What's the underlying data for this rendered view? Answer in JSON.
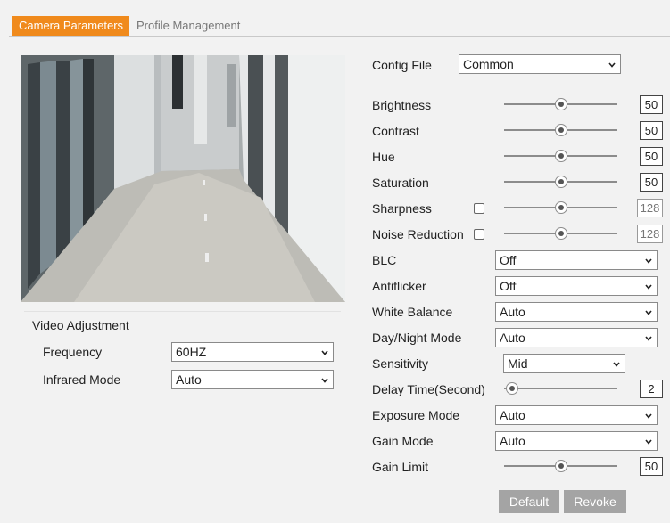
{
  "tabs": [
    {
      "label": "Camera Parameters",
      "active": true
    },
    {
      "label": "Profile Management",
      "active": false
    }
  ],
  "video_adjustment": {
    "title": "Video Adjustment",
    "frequency": {
      "label": "Frequency",
      "value": "60HZ"
    },
    "infrared": {
      "label": "Infrared Mode",
      "value": "Auto"
    }
  },
  "config_file": {
    "label": "Config File",
    "value": "Common"
  },
  "image": {
    "brightness": {
      "label": "Brightness",
      "value": "50",
      "level": 0.5
    },
    "contrast": {
      "label": "Contrast",
      "value": "50",
      "level": 0.5
    },
    "hue": {
      "label": "Hue",
      "value": "50",
      "level": 0.5
    },
    "saturation": {
      "label": "Saturation",
      "value": "50",
      "level": 0.5
    },
    "sharpness": {
      "label": "Sharpness",
      "value": "128",
      "level": 0.5,
      "checked": false
    },
    "noise_reduction": {
      "label": "Noise Reduction",
      "value": "128",
      "level": 0.5,
      "checked": false
    }
  },
  "blc": {
    "label": "BLC",
    "value": "Off"
  },
  "antiflicker": {
    "label": "Antiflicker",
    "value": "Off"
  },
  "white_balance": {
    "label": "White Balance",
    "value": "Auto"
  },
  "day_night": {
    "label": "Day/Night Mode",
    "value": "Auto"
  },
  "sensitivity": {
    "label": "Sensitivity",
    "value": "Mid"
  },
  "delay_time": {
    "label": "Delay Time(Second)",
    "value": "2",
    "level": 0.02
  },
  "exposure_mode": {
    "label": "Exposure Mode",
    "value": "Auto"
  },
  "gain_mode": {
    "label": "Gain Mode",
    "value": "Auto"
  },
  "gain_limit": {
    "label": "Gain Limit",
    "value": "50",
    "level": 0.5
  },
  "buttons": {
    "default": "Default",
    "revoke": "Revoke"
  },
  "colors": {
    "accent": "#f08a1c",
    "button": "#a4a4a4"
  },
  "icons": {
    "dropdown": "chevron-down-icon",
    "slider": "slider-thumb-icon"
  }
}
